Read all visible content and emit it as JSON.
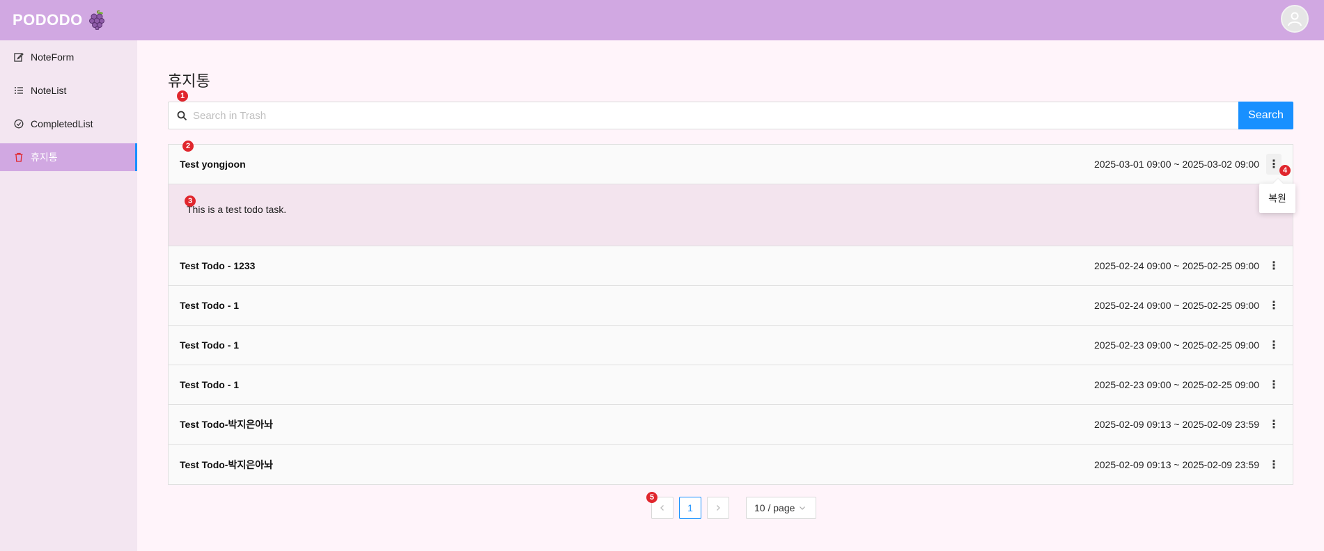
{
  "header": {
    "logo_text": "PODODO",
    "logo_icon": "grape-icon",
    "avatar_icon": "user-icon"
  },
  "sidebar": {
    "items": [
      {
        "label": "NoteForm",
        "icon": "edit-icon"
      },
      {
        "label": "NoteList",
        "icon": "list-icon"
      },
      {
        "label": "CompletedList",
        "icon": "check-circle-icon"
      },
      {
        "label": "휴지통",
        "icon": "trash-icon",
        "active": true
      }
    ]
  },
  "main": {
    "title": "휴지통",
    "search": {
      "placeholder": "Search in Trash",
      "button_label": "Search"
    },
    "rows": [
      {
        "title": "Test yongjoon",
        "date": "2025-03-01 09:00 ~ 2025-03-02 09:00",
        "expanded": true,
        "detail": "This is a test todo task."
      },
      {
        "title": "Test Todo - 1233",
        "date": "2025-02-24 09:00 ~ 2025-02-25 09:00"
      },
      {
        "title": "Test Todo - 1",
        "date": "2025-02-24 09:00 ~ 2025-02-25 09:00"
      },
      {
        "title": "Test Todo - 1",
        "date": "2025-02-23 09:00 ~ 2025-02-25 09:00"
      },
      {
        "title": "Test Todo - 1",
        "date": "2025-02-23 09:00 ~ 2025-02-25 09:00"
      },
      {
        "title": "Test Todo-박지은아놔",
        "date": "2025-02-09 09:13 ~ 2025-02-09 23:59"
      },
      {
        "title": "Test Todo-박지은아놔",
        "date": "2025-02-09 09:13 ~ 2025-02-09 23:59"
      }
    ],
    "popover": {
      "label": "복원"
    }
  },
  "pagination": {
    "prev": "<",
    "current": "1",
    "next": ">",
    "page_size": "10 / page"
  },
  "markers": [
    "1",
    "2",
    "3",
    "4",
    "5"
  ],
  "colors": {
    "header": "#d1a8e2",
    "accent": "#1890ff",
    "marker": "#e0262d"
  }
}
